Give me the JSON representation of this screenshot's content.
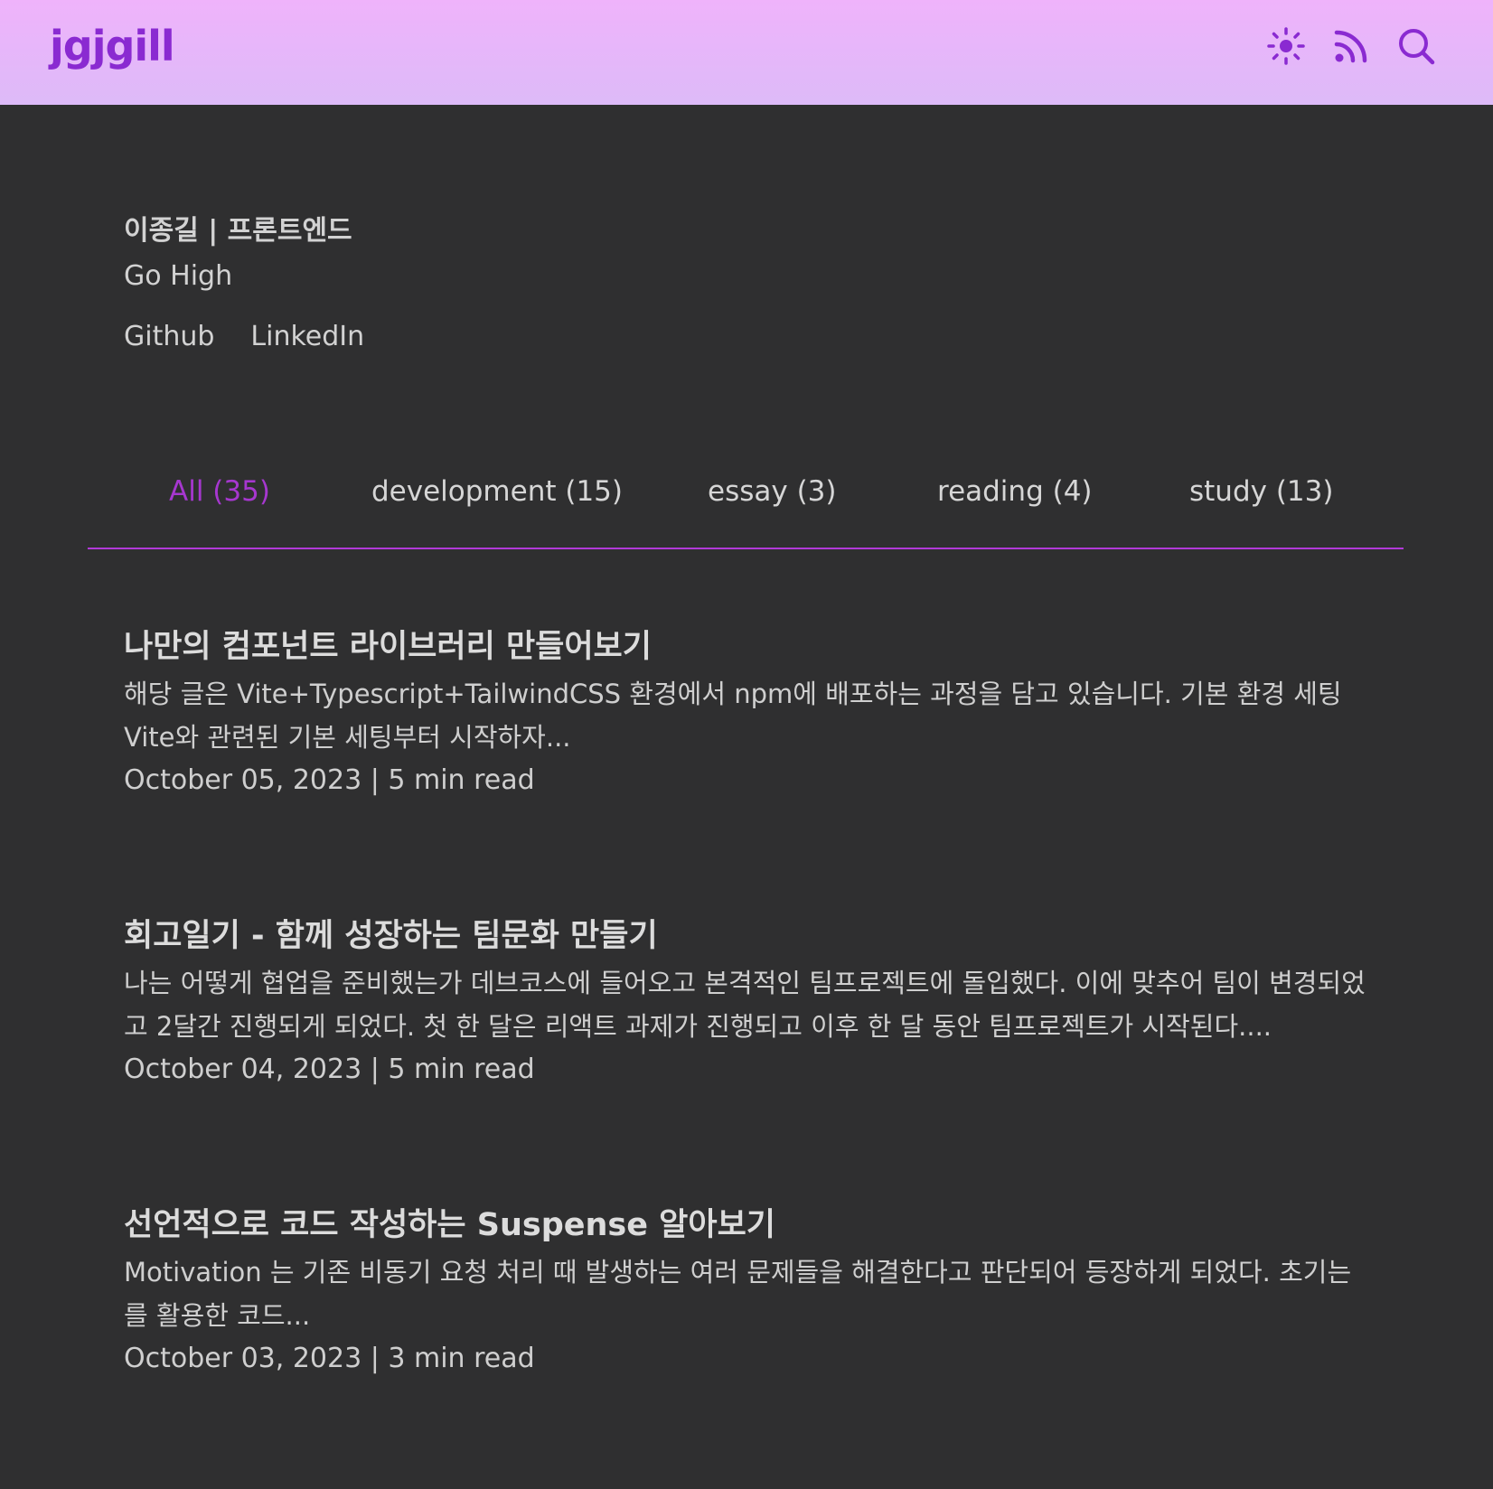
{
  "header": {
    "logo": "jgjgill",
    "icons": [
      "sun-icon",
      "rss-icon",
      "search-icon"
    ],
    "accent": "#8a2ad1"
  },
  "bio": {
    "name": "이종길 | 프론트엔드",
    "tagline": "Go High",
    "links": [
      "Github",
      "LinkedIn"
    ]
  },
  "tabs": [
    {
      "label": "All (35)",
      "active": true
    },
    {
      "label": "development (15)",
      "active": false
    },
    {
      "label": "essay (3)",
      "active": false
    },
    {
      "label": "reading (4)",
      "active": false
    },
    {
      "label": "study (13)",
      "active": false
    }
  ],
  "posts": [
    {
      "title": "나만의 컴포넌트 라이브러리 만들어보기",
      "excerpt": "해당 글은 Vite+Typescript+TailwindCSS 환경에서 npm에 배포하는 과정을 담고 있습니다. 기본 환경 세팅 Vite와 관련된 기본 세팅부터 시작하자...",
      "meta": "October 05, 2023 | 5 min read"
    },
    {
      "title": "회고일기 - 함께 성장하는 팀문화 만들기",
      "excerpt": "나는 어떻게 협업을 준비했는가 데브코스에 들어오고 본격적인 팀프로젝트에 돌입했다. 이에 맞추어 팀이 변경되었고 2달간 진행되게 되었다. 첫 한 달은 리액트 과제가 진행되고 이후 한 달 동안 팀프로젝트가 시작된다....",
      "meta": "October 04, 2023 | 5 min read"
    },
    {
      "title": "선언적으로 코드 작성하는 Suspense 알아보기",
      "excerpt": "Motivation 는 기존 비동기 요청 처리 때 발생하는 여러 문제들을 해결한다고 판단되어 등장하게 되었다. 초기는 를 활용한 코드...",
      "meta": "October 03, 2023 | 3 min read"
    }
  ]
}
